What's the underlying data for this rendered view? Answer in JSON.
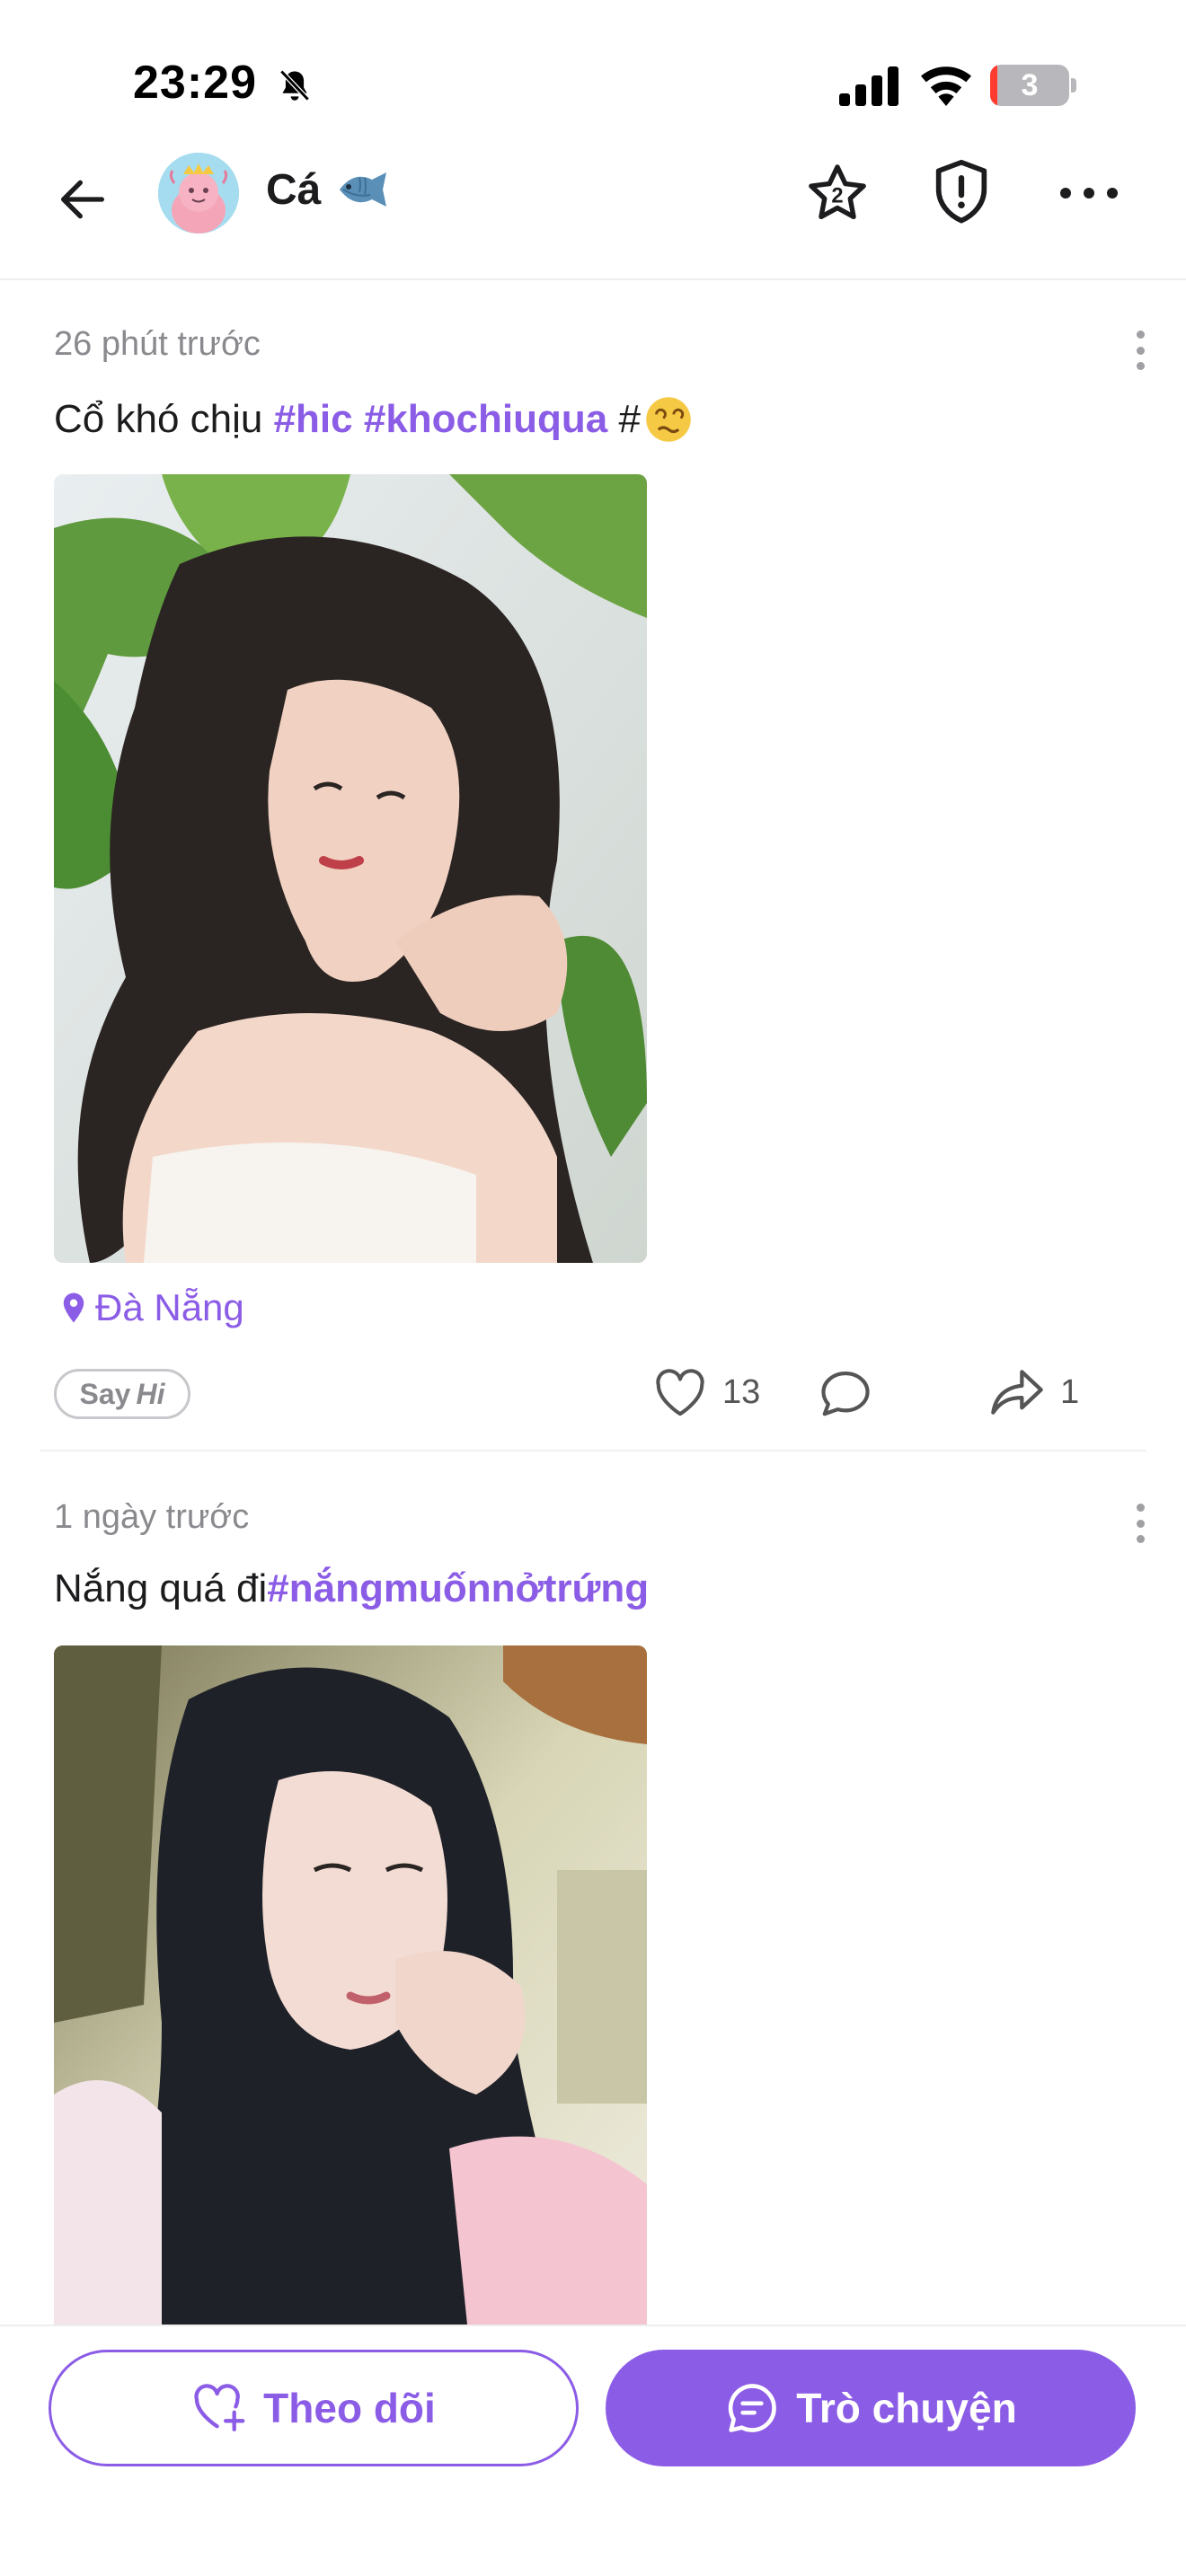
{
  "status_bar": {
    "time": "23:29",
    "battery_level": "3",
    "icons": [
      "bell-muted-icon",
      "cellular-signal-icon",
      "wifi-icon",
      "battery-icon"
    ]
  },
  "header": {
    "back_icon": "arrow-left-icon",
    "user_name": "Cá",
    "name_emoji": "fish-icon",
    "actions": [
      "star-2-icon",
      "shield-alert-icon",
      "more-horizontal-icon"
    ]
  },
  "posts": [
    {
      "time": "26 phút trước",
      "text_plain": "Cổ khó chịu ",
      "hashtags": [
        "#hic",
        "#khochiuqua",
        "#"
      ],
      "emoji": "dizzy-face-icon",
      "photo": "selfie-photo-plants",
      "location": "Đà Nẵng",
      "sayhi_prefix": "Say",
      "sayhi_suffix": "Hi",
      "likes": "13",
      "comments": "",
      "shares": "1"
    },
    {
      "time": "1 ngày trước",
      "text_plain": "Nắng quá đi",
      "hashtags": [
        "#nắngmuốnnởtrứng"
      ],
      "photo": "selfie-photo-long-hair"
    }
  ],
  "bottom_bar": {
    "follow_label": "Theo dõi",
    "chat_label": "Trò chuyện"
  },
  "colors": {
    "accent": "#8b5ce6",
    "text_primary": "#1c1c1e",
    "text_secondary": "#8a8a8e"
  }
}
